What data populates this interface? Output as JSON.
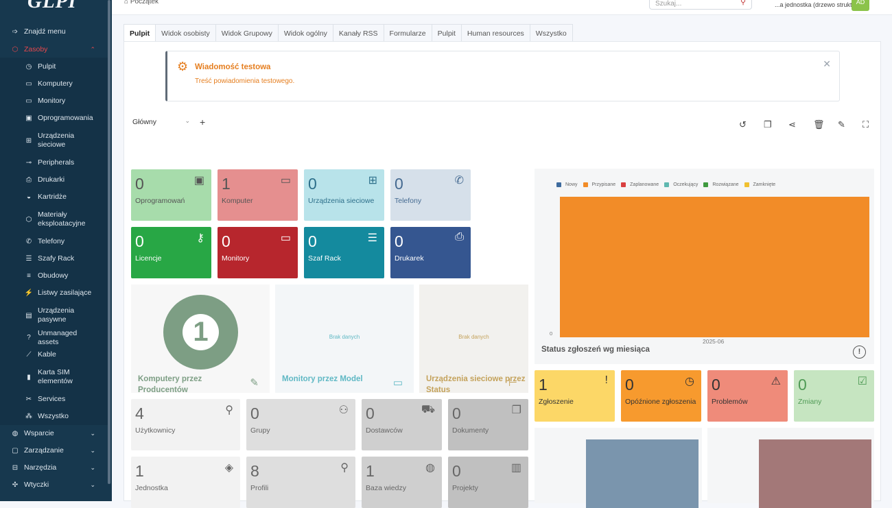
{
  "sidebar": {
    "logo": "GLPI",
    "find_menu": "Znajdź menu",
    "assets": "Zasoby",
    "items": [
      {
        "label": "Pulpit",
        "icon": "dashboard-icon",
        "glyph": "◷"
      },
      {
        "label": "Komputery",
        "icon": "laptop-icon",
        "glyph": "▭"
      },
      {
        "label": "Monitory",
        "icon": "monitor-icon",
        "glyph": "▭"
      },
      {
        "label": "Oprogramowania",
        "icon": "apps-icon",
        "glyph": "▣"
      },
      {
        "label": "Urządzenia sieciowe",
        "icon": "network-icon",
        "glyph": "⊞"
      },
      {
        "label": "Peripherals",
        "icon": "usb-icon",
        "glyph": "⊸"
      },
      {
        "label": "Drukarki",
        "icon": "printer-icon",
        "glyph": "⎙"
      },
      {
        "label": "Kartridże",
        "icon": "droplet-icon",
        "glyph": "◒"
      },
      {
        "label": "Materiały eksploatacyjne",
        "icon": "package-icon",
        "glyph": "⬡"
      },
      {
        "label": "Telefony",
        "icon": "phone-icon",
        "glyph": "✆"
      },
      {
        "label": "Szafy Rack",
        "icon": "server-icon",
        "glyph": "☰"
      },
      {
        "label": "Obudowy",
        "icon": "enclosure-icon",
        "glyph": "≡"
      },
      {
        "label": "Listwy zasilające",
        "icon": "plug-icon",
        "glyph": "⚡"
      },
      {
        "label": "Urządzenia pasywne",
        "icon": "box-icon",
        "glyph": "▤"
      },
      {
        "label": "Unmanaged assets",
        "icon": "question-icon",
        "glyph": "?"
      },
      {
        "label": "Kable",
        "icon": "cable-icon",
        "glyph": "⟋"
      },
      {
        "label": "Karta SIM elementów",
        "icon": "sim-icon",
        "glyph": "▮"
      },
      {
        "label": "Services",
        "icon": "tools-icon",
        "glyph": "✂"
      },
      {
        "label": "Wszystko",
        "icon": "cubes-icon",
        "glyph": "⁂"
      }
    ],
    "groups": [
      {
        "label": "Wsparcie",
        "icon": "lifebuoy-icon",
        "glyph": "◍"
      },
      {
        "label": "Zarządzanie",
        "icon": "wallet-icon",
        "glyph": "▢"
      },
      {
        "label": "Narzędzia",
        "icon": "briefcase-icon",
        "glyph": "⊟"
      },
      {
        "label": "Wtyczki",
        "icon": "puzzle-icon",
        "glyph": "✣"
      }
    ]
  },
  "topbar": {
    "breadcrumb": "Początek",
    "search_placeholder": "Szukaj...",
    "entity": "...a jednostka (drzewo struktury)",
    "avatar": "AD"
  },
  "tabs": [
    "Pulpit",
    "Widok osobisty",
    "Widok Grupowy",
    "Widok ogólny",
    "Kanały RSS",
    "Formularze",
    "Pulpit",
    "Human resources",
    "Wszystko"
  ],
  "alert": {
    "title": "Wiadomość testowa",
    "body": "Treść powiadomienia testowego."
  },
  "dashboard": {
    "selected": "Główny"
  },
  "cards": [
    {
      "value": "0",
      "label": "Oprogramowań",
      "color": "#a7dcab",
      "icon": "apps-icon",
      "glyph": "▣",
      "light": true
    },
    {
      "value": "1",
      "label": "Komputer",
      "color": "#e58f8f",
      "icon": "laptop-icon",
      "glyph": "▭",
      "light": true
    },
    {
      "value": "0",
      "label": "Urządzenia sieciowe",
      "color": "#b8e3ea",
      "icon": "network-icon",
      "glyph": "⊞",
      "light": false,
      "textcolor": "#2d6f8a"
    },
    {
      "value": "0",
      "label": "Telefony",
      "color": "#d6e0ea",
      "icon": "phone-icon",
      "glyph": "✆",
      "light": false,
      "textcolor": "#456a91"
    },
    {
      "value": "0",
      "label": "Licencje",
      "color": "#28a745",
      "icon": "key-icon",
      "glyph": "⚷",
      "light": false
    },
    {
      "value": "0",
      "label": "Monitory",
      "color": "#b7262d",
      "icon": "monitor-icon",
      "glyph": "▭",
      "light": false
    },
    {
      "value": "0",
      "label": "Szaf Rack",
      "color": "#148a9e",
      "icon": "server-icon",
      "glyph": "☰",
      "light": false
    },
    {
      "value": "0",
      "label": "Drukarek",
      "color": "#355690",
      "icon": "printer-icon",
      "glyph": "⎙",
      "light": false
    }
  ],
  "panels": [
    {
      "title": "Komputery przez Producentów",
      "value": "1",
      "nodata": "",
      "color": "#7d9e84",
      "icon": "edit-icon",
      "glyph": "✎"
    },
    {
      "title": "Monitory przez Model",
      "value": "",
      "nodata": "Brak danych",
      "color": "#5fb8c4",
      "icon": "monitor-icon",
      "glyph": "▭"
    },
    {
      "title": "Urządzenia sieciowe przez Status",
      "value": "",
      "nodata": "Brak danych",
      "color": "#c4a25b",
      "icon": "hierarchy-icon",
      "glyph": "⊢"
    }
  ],
  "chart_data": {
    "type": "bar",
    "title": "Status zgłoszeń wg miesiąca",
    "categories": [
      "2025-06"
    ],
    "series": [
      {
        "name": "Nowy",
        "color": "#3e6b9e",
        "values": [
          0
        ]
      },
      {
        "name": "Przypisane",
        "color": "#f28c28",
        "values": [
          1
        ]
      },
      {
        "name": "Zaplanowane",
        "color": "#d94040",
        "values": [
          0
        ]
      },
      {
        "name": "Oczekujący",
        "color": "#5fb8b0",
        "values": [
          0
        ]
      },
      {
        "name": "Rozwiązane",
        "color": "#3f9a3f",
        "values": [
          0
        ]
      },
      {
        "name": "Zamknięte",
        "color": "#f0c030",
        "values": [
          0
        ]
      }
    ],
    "ytick": "0",
    "legend": "top-left"
  },
  "tickets": [
    {
      "value": "1",
      "label": "Zgłoszenie",
      "color": "#fcd767",
      "icon": "alert-circle-icon",
      "glyph": "!"
    },
    {
      "value": "0",
      "label": "Opóźnione zgłoszenia",
      "color": "#f79a2e",
      "icon": "clock-icon",
      "glyph": "◷"
    },
    {
      "value": "0",
      "label": "Problemów",
      "color": "#ef8b7a",
      "icon": "alert-triangle-icon",
      "glyph": "⚠"
    },
    {
      "value": "0",
      "label": "Zmiany",
      "color": "#c6e5c1",
      "icon": "clipboard-check-icon",
      "glyph": "☑"
    }
  ],
  "bottom": [
    {
      "value": "4",
      "label": "Użytkownicy",
      "color": "#f2f2f2",
      "icon": "user-icon",
      "glyph": "⚲"
    },
    {
      "value": "0",
      "label": "Grupy",
      "color": "#dedede",
      "icon": "users-icon",
      "glyph": "⚇"
    },
    {
      "value": "0",
      "label": "Dostawców",
      "color": "#cfcfcf",
      "icon": "dolly-icon",
      "glyph": "⛟"
    },
    {
      "value": "0",
      "label": "Dokumenty",
      "color": "#c0c0c0",
      "icon": "files-icon",
      "glyph": "❐"
    },
    {
      "value": "1",
      "label": "Jednostka",
      "color": "#f2f2f2",
      "icon": "stack-icon",
      "glyph": "◈"
    },
    {
      "value": "8",
      "label": "Profili",
      "color": "#dedede",
      "icon": "user-check-icon",
      "glyph": "⚲"
    },
    {
      "value": "1",
      "label": "Baza wiedzy",
      "color": "#cfcfcf",
      "icon": "lifebuoy-icon",
      "glyph": "◍"
    },
    {
      "value": "0",
      "label": "Projekty",
      "color": "#c0c0c0",
      "icon": "project-icon",
      "glyph": "▥"
    }
  ],
  "mini_colors": [
    "#7a95ad",
    "#a37878"
  ]
}
